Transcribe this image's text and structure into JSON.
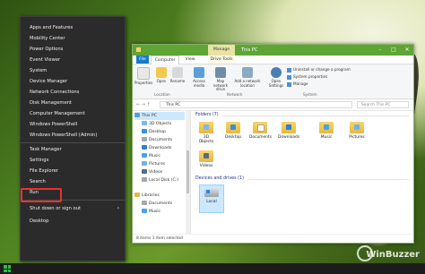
{
  "winx_menu": {
    "items": [
      "Apps and Features",
      "Mobility Center",
      "Power Options",
      "Event Viewer",
      "System",
      "Device Manager",
      "Network Connections",
      "Disk Management",
      "Computer Management",
      "Windows PowerShell",
      "Windows PowerShell (Admin)",
      "Task Manager",
      "Settings",
      "File Explorer",
      "Search",
      "Run",
      "Shut down or sign out",
      "Desktop"
    ],
    "highlighted": "File Explorer"
  },
  "explorer": {
    "manage_tab": "Manage",
    "window_title": "This PC",
    "tabs": [
      "File",
      "Computer",
      "View",
      "Drive Tools"
    ],
    "ribbon": {
      "buttons": [
        "Properties",
        "Open",
        "Rename",
        "Access media",
        "Map network drive",
        "Add a network location",
        "Open Settings"
      ],
      "small": [
        "Uninstall or change a program",
        "System properties",
        "Manage"
      ],
      "groups": [
        "Location",
        "Network",
        "System"
      ]
    },
    "address": "This PC",
    "search_placeholder": "Search This PC",
    "nav": [
      "This PC",
      "3D Objects",
      "Desktop",
      "Documents",
      "Downloads",
      "Music",
      "Pictures",
      "Videos",
      "Local Disk (C:)",
      "Libraries",
      "Documents",
      "Music"
    ],
    "folders_header": "Folders (7)",
    "folders": [
      "3D Objects",
      "Desktop",
      "Documents",
      "Downloads",
      "Music",
      "Pictures",
      "Videos"
    ],
    "devices_header": "Devices and drives (1)",
    "drive": "Local",
    "status": "8 items   1 item selected"
  },
  "watermark": "WinBuzzer"
}
